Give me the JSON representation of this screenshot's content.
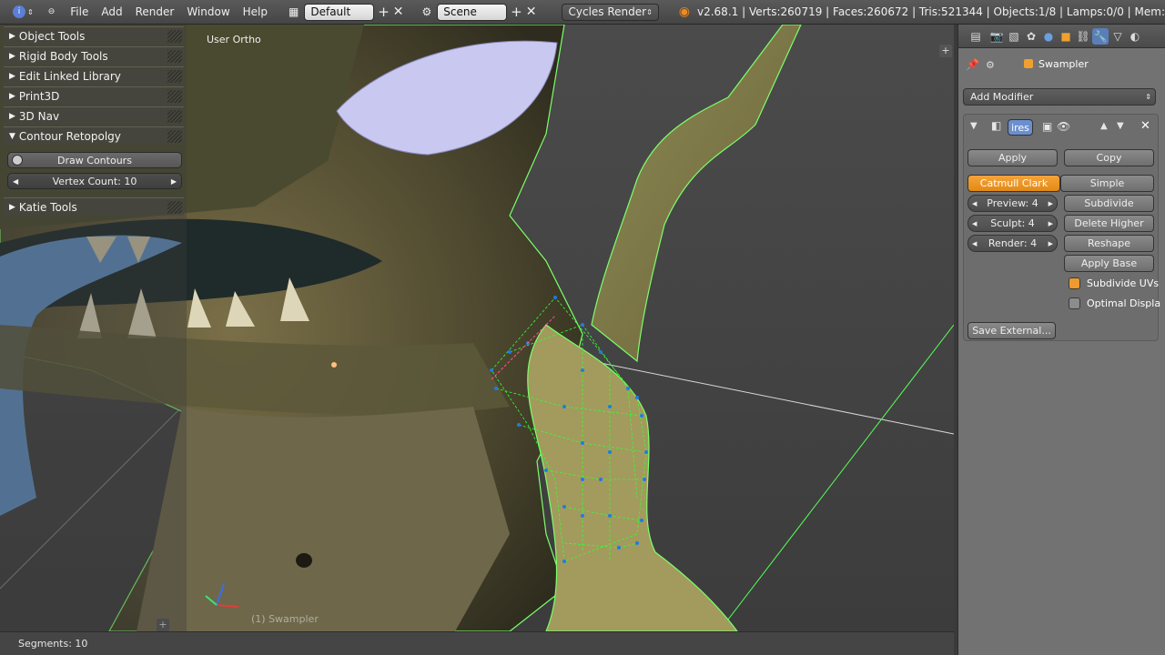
{
  "topbar": {
    "menus": [
      "File",
      "Add",
      "Render",
      "Window",
      "Help"
    ],
    "screen_layout": "Default",
    "scene": "Scene",
    "render_engine": "Cycles Render",
    "stats": "v2.68.1 | Verts:260719 | Faces:260672 | Tris:521344 | Objects:1/8 | Lamps:0/0 | Mem:"
  },
  "viewport": {
    "view_label": "User Ortho",
    "object_label": "(1) Swampler"
  },
  "tools": {
    "panels": [
      "Object Tools",
      "Rigid Body Tools",
      "Edit Linked Library",
      "Print3D",
      "3D Nav",
      "Contour Retopolgy",
      "Katie Tools"
    ],
    "draw_contours": "Draw Contours",
    "vertex_count": "Vertex Count: 10"
  },
  "statusbar": {
    "text": "Segments: 10"
  },
  "properties": {
    "object_name": "Swampler",
    "add_modifier": "Add Modifier",
    "modifier_name": "ires",
    "apply": "Apply",
    "copy": "Copy",
    "catmull_clark": "Catmull Clark",
    "simple": "Simple",
    "preview": "Preview: 4",
    "sculpt": "Sculpt: 4",
    "render": "Render: 4",
    "subdivide": "Subdivide",
    "delete_higher": "Delete Higher",
    "reshape": "Reshape",
    "apply_base": "Apply Base",
    "subdivide_uvs": "Subdivide UVs",
    "optimal_display": "Optimal Displa",
    "save_external": "Save External..."
  },
  "colors": {
    "accent": "#f0a030",
    "wire": "#33ff33",
    "retopo": "#1e7be6"
  }
}
